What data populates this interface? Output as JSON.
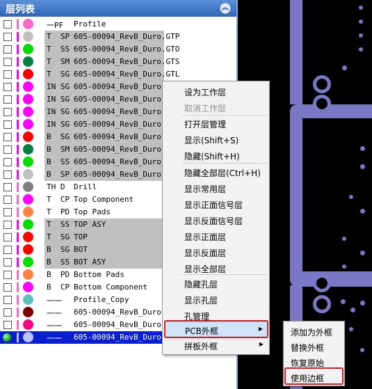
{
  "panel": {
    "title": "层列表",
    "collapse_icon": "double-chevron-up-icon"
  },
  "layers": [
    {
      "type": "一PF",
      "name": "Profile",
      "color": "#ff66cc",
      "bar": "#ff66cc",
      "gray": false
    },
    {
      "type": "T  SP",
      "name": "605-00094_RevB_Duro.GTP",
      "color": "#c0c0c0",
      "bar": "#ff00ff",
      "gray": true
    },
    {
      "type": "T  SS",
      "name": "605-00094_RevB_Duro.GTO",
      "color": "#00dd00",
      "bar": "#ff00ff",
      "gray": true
    },
    {
      "type": "T  SM",
      "name": "605-00094_RevB_Duro.GTS",
      "color": "#008040",
      "bar": "#ff00ff",
      "gray": true
    },
    {
      "type": "T  SG",
      "name": "605-00094_RevB_Duro.GTL",
      "color": "#ff0000",
      "bar": "#ff00ff",
      "gray": true
    },
    {
      "type": "IN SG",
      "name": "605-00094_RevB_Duro.G",
      "color": "#ff00ff",
      "bar": "#ff00ff",
      "gray": true
    },
    {
      "type": "IN SG",
      "name": "605-00094_RevB_Duro.G",
      "color": "#ff00ff",
      "bar": "#ff00ff",
      "gray": true
    },
    {
      "type": "IN SG",
      "name": "605-00094_RevB_Duro.G",
      "color": "#ff00ff",
      "bar": "#ff00ff",
      "gray": true
    },
    {
      "type": "IN SG",
      "name": "605-00094_RevB_Duro.G",
      "color": "#ff00ff",
      "bar": "#ff00ff",
      "gray": true
    },
    {
      "type": "B  SG",
      "name": "605-00094_RevB_Duro.G",
      "color": "#ff0000",
      "bar": "#ff00ff",
      "gray": true
    },
    {
      "type": "B  SM",
      "name": "605-00094_RevB_Duro.G",
      "color": "#008040",
      "bar": "#ff00ff",
      "gray": true
    },
    {
      "type": "B  SS",
      "name": "605-00094_RevB_Duro.G",
      "color": "#00dd00",
      "bar": "#ff00ff",
      "gray": true
    },
    {
      "type": "B  SP",
      "name": "605-00094_RevB_Duro.G",
      "color": "#c0c0c0",
      "bar": "#ff00ff",
      "gray": true
    },
    {
      "type": "TH D",
      "name": "Drill",
      "color": "#808080",
      "bar": "#ff66cc",
      "gray": false
    },
    {
      "type": "T  CP",
      "name": "Top Component",
      "color": "#ff00ff",
      "bar": "#ff66cc",
      "gray": false
    },
    {
      "type": "T  PD",
      "name": "Top Pads",
      "color": "#ff8040",
      "bar": "#ff66cc",
      "gray": false
    },
    {
      "type": "T  SS",
      "name": "TOP ASY",
      "color": "#00dd00",
      "bar": "#ff00ff",
      "gray": true
    },
    {
      "type": "T  SG",
      "name": "TOP",
      "color": "#ff0000",
      "bar": "#ff00ff",
      "gray": true
    },
    {
      "type": "B  SG",
      "name": "BOT",
      "color": "#ff0000",
      "bar": "#ff00ff",
      "gray": true
    },
    {
      "type": "B  SS",
      "name": "BOT ASY",
      "color": "#00dd00",
      "bar": "#ff00ff",
      "gray": true
    },
    {
      "type": "B  PD",
      "name": "Bottom Pads",
      "color": "#ff8040",
      "bar": "#ff66cc",
      "gray": false
    },
    {
      "type": "B  CP",
      "name": "Bottom Component",
      "color": "#ff00ff",
      "bar": "#ff66cc",
      "gray": false
    },
    {
      "type": "一一",
      "name": "Profile_Copy",
      "color": "#60c0c0",
      "bar": "#ff66cc",
      "gray": false
    },
    {
      "type": "一一",
      "name": "605-00094_RevB_Duro.G",
      "color": "#800000",
      "bar": "#ff66cc",
      "gray": false
    },
    {
      "type": "一一",
      "name": "605-00094_RevB_Duro.G",
      "color": "#ff0080",
      "bar": "#ff66cc",
      "gray": false
    },
    {
      "type": "一一",
      "name": "605-00094_RevB_Duro.G",
      "color": "#c0c0ff",
      "bar": "#c0c0ff",
      "gray": false,
      "selected": true
    }
  ],
  "context_menu": {
    "items": [
      {
        "label": "设为工作层",
        "disabled": false
      },
      {
        "label": "取消工作层",
        "disabled": true
      },
      {
        "label": "打开层管理",
        "disabled": false
      },
      {
        "label": "显示(Shift+S)",
        "disabled": false
      },
      {
        "label": "隐藏(Shift+H)",
        "disabled": false
      },
      {
        "label": "隐藏全部层(Ctrl+H)",
        "disabled": false
      },
      {
        "label": "显示常用层",
        "disabled": false
      },
      {
        "label": "显示正面信号层",
        "disabled": false
      },
      {
        "label": "显示反面信号层",
        "disabled": false
      },
      {
        "label": "显示正面层",
        "disabled": false
      },
      {
        "label": "显示反面层",
        "disabled": false
      },
      {
        "label": "显示全部层",
        "disabled": false
      },
      {
        "label": "隐藏孔层",
        "disabled": false
      },
      {
        "label": "显示孔层",
        "disabled": false
      },
      {
        "label": "孔管理",
        "disabled": false
      },
      {
        "label": "PCB外框",
        "disabled": false,
        "submenu": true,
        "hover": true
      },
      {
        "label": "拼板外框",
        "disabled": false,
        "submenu": true
      }
    ]
  },
  "submenu": {
    "items": [
      {
        "label": "添加为外框"
      },
      {
        "label": "替换外框"
      },
      {
        "label": "恢复原始"
      },
      {
        "label": "使用边框",
        "highlighted": true
      }
    ]
  },
  "colors": {
    "accent": "#2f66b8",
    "selection": "#0a1fd0",
    "highlight_box": "#e02020",
    "pcb_copper": "#7a78c4"
  }
}
